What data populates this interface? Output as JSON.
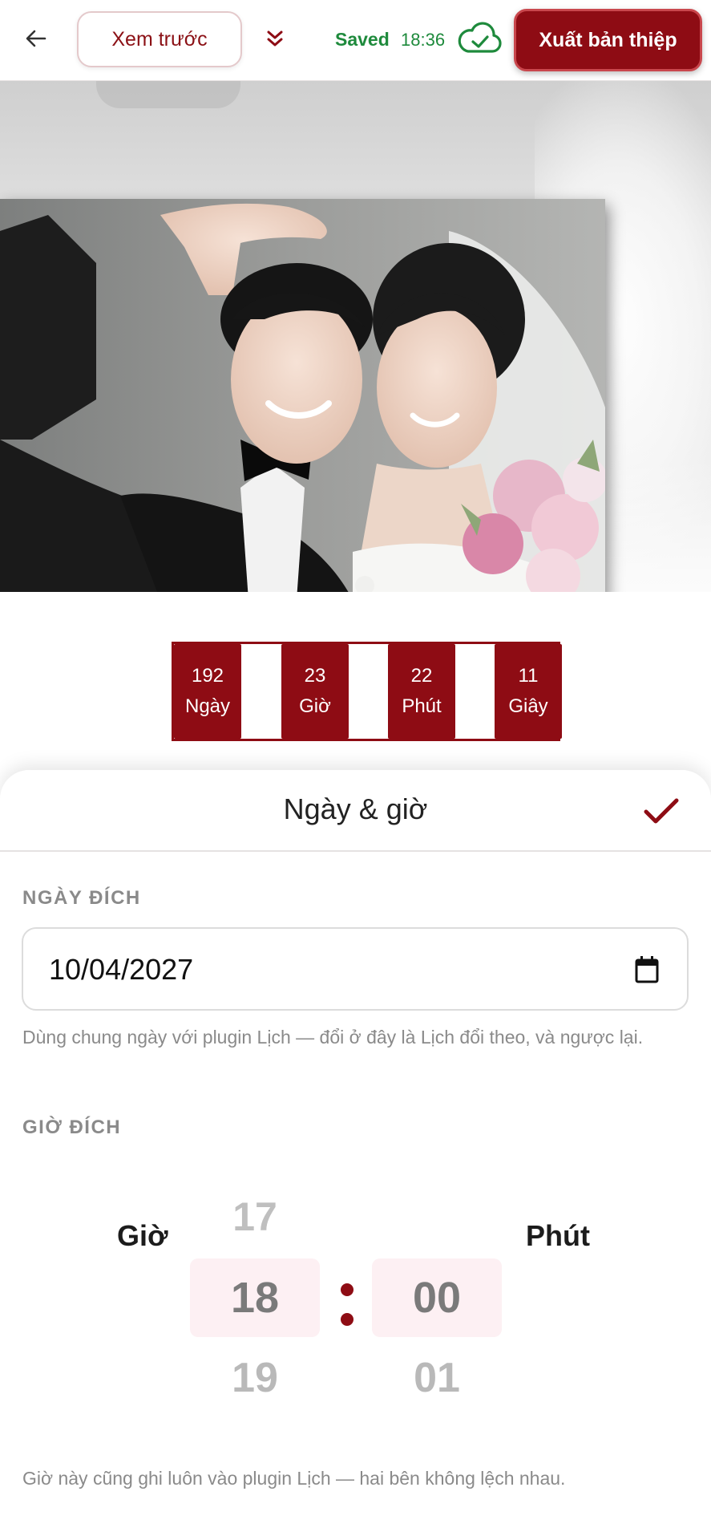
{
  "topbar": {
    "back_icon": "arrow-left-icon",
    "preview_label": "Xem trước",
    "collapse_icon": "double-chevron-down-icon",
    "saved_label": "Saved",
    "saved_time": "18:36",
    "cloud_icon": "cloud-check-icon",
    "export_label": "Xuất bản thiệp"
  },
  "colors": {
    "accent": "#8e0c14",
    "saved_green": "#1e8a3c",
    "label_gray": "#8a8a8a",
    "picker_highlight": "#fdf0f3"
  },
  "countdown": [
    {
      "value": "192",
      "unit": "Ngày"
    },
    {
      "value": "23",
      "unit": "Giờ"
    },
    {
      "value": "22",
      "unit": "Phút"
    },
    {
      "value": "11",
      "unit": "Giây"
    }
  ],
  "sheet": {
    "title": "Ngày & giờ",
    "confirm_icon": "checkmark-icon",
    "date_section_label": "NGÀY ĐÍCH",
    "date_value": "10/04/2027",
    "calendar_icon": "calendar-icon",
    "date_hint": "Dùng chung ngày với plugin Lịch — đổi ở đây là Lịch đổi theo, và ngược lại.",
    "time_section_label": "GIỜ ĐÍCH",
    "hour_label": "Giờ",
    "minute_label": "Phút",
    "hour_prev": "17",
    "hour_selected": "18",
    "hour_next": "19",
    "minute_selected": "00",
    "minute_next": "01",
    "time_hint": "Giờ này cũng ghi luôn vào plugin Lịch — hai bên không lệch nhau."
  }
}
